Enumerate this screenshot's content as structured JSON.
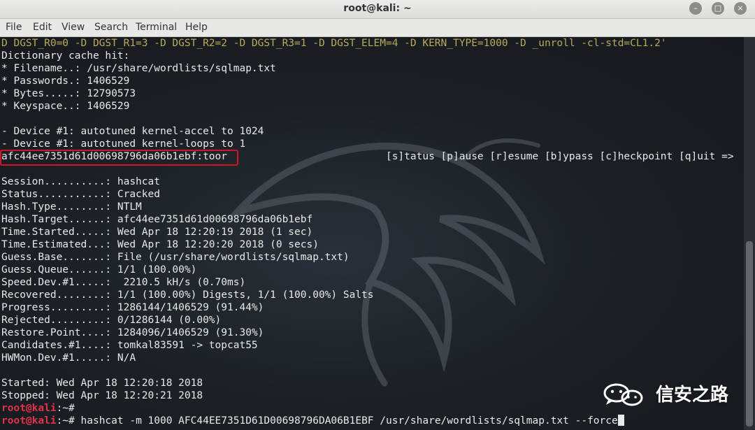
{
  "window": {
    "title": "root@kali: ~",
    "controls": {
      "minimize": "–",
      "maximize": "□",
      "close": "×"
    }
  },
  "menu": [
    "File",
    "Edit",
    "View",
    "Search",
    "Terminal",
    "Help"
  ],
  "terminal": {
    "lines": [
      "D DGST_R0=0 -D DGST_R1=3 -D DGST_R2=2 -D DGST_R3=1 -D DGST_ELEM=4 -D KERN_TYPE=1000 -D _unroll -cl-std=CL1.2'",
      "Dictionary cache hit:",
      "* Filename..: /usr/share/wordlists/sqlmap.txt",
      "* Passwords.: 1406529",
      "* Bytes.....: 12790573",
      "* Keyspace..: 1406529",
      "",
      "- Device #1: autotuned kernel-accel to 1024",
      "- Device #1: autotuned kernel-loops to 1",
      "afc44ee7351d61d00698796da06b1ebf:toor                          [s]tatus [p]ause [r]esume [b]ypass [c]heckpoint [q]uit =>",
      "",
      "Session..........: hashcat",
      "Status...........: Cracked",
      "Hash.Type........: NTLM",
      "Hash.Target......: afc44ee7351d61d00698796da06b1ebf",
      "Time.Started.....: Wed Apr 18 12:20:19 2018 (1 sec)",
      "Time.Estimated...: Wed Apr 18 12:20:20 2018 (0 secs)",
      "Guess.Base.......: File (/usr/share/wordlists/sqlmap.txt)",
      "Guess.Queue......: 1/1 (100.00%)",
      "Speed.Dev.#1.....:  2210.5 kH/s (0.70ms)",
      "Recovered........: 1/1 (100.00%) Digests, 1/1 (100.00%) Salts",
      "Progress.........: 1286144/1406529 (91.44%)",
      "Rejected.........: 0/1286144 (0.00%)",
      "Restore.Point....: 1284096/1406529 (91.30%)",
      "Candidates.#1....: tomkal83591 -> topcat55",
      "HWMon.Dev.#1.....: N/A",
      "",
      "Started: Wed Apr 18 12:20:18 2018",
      "Stopped: Wed Apr 18 12:20:21 2018"
    ],
    "prompt_user": "root@kali",
    "prompt_path": ":~# ",
    "last_command": "hashcat -m 1000 AFC44EE7351D61D00698796DA06B1EBF /usr/share/wordlists/sqlmap.txt --force"
  },
  "watermark": {
    "text": "信安之路",
    "icon": "wechat-icon"
  },
  "colors": {
    "terminal_bg": "#1d2127",
    "text": "#e9e9e9",
    "prompt_user": "#e0334a",
    "highlight_border": "#d0142a",
    "compile_line": "#b9aa5a"
  }
}
